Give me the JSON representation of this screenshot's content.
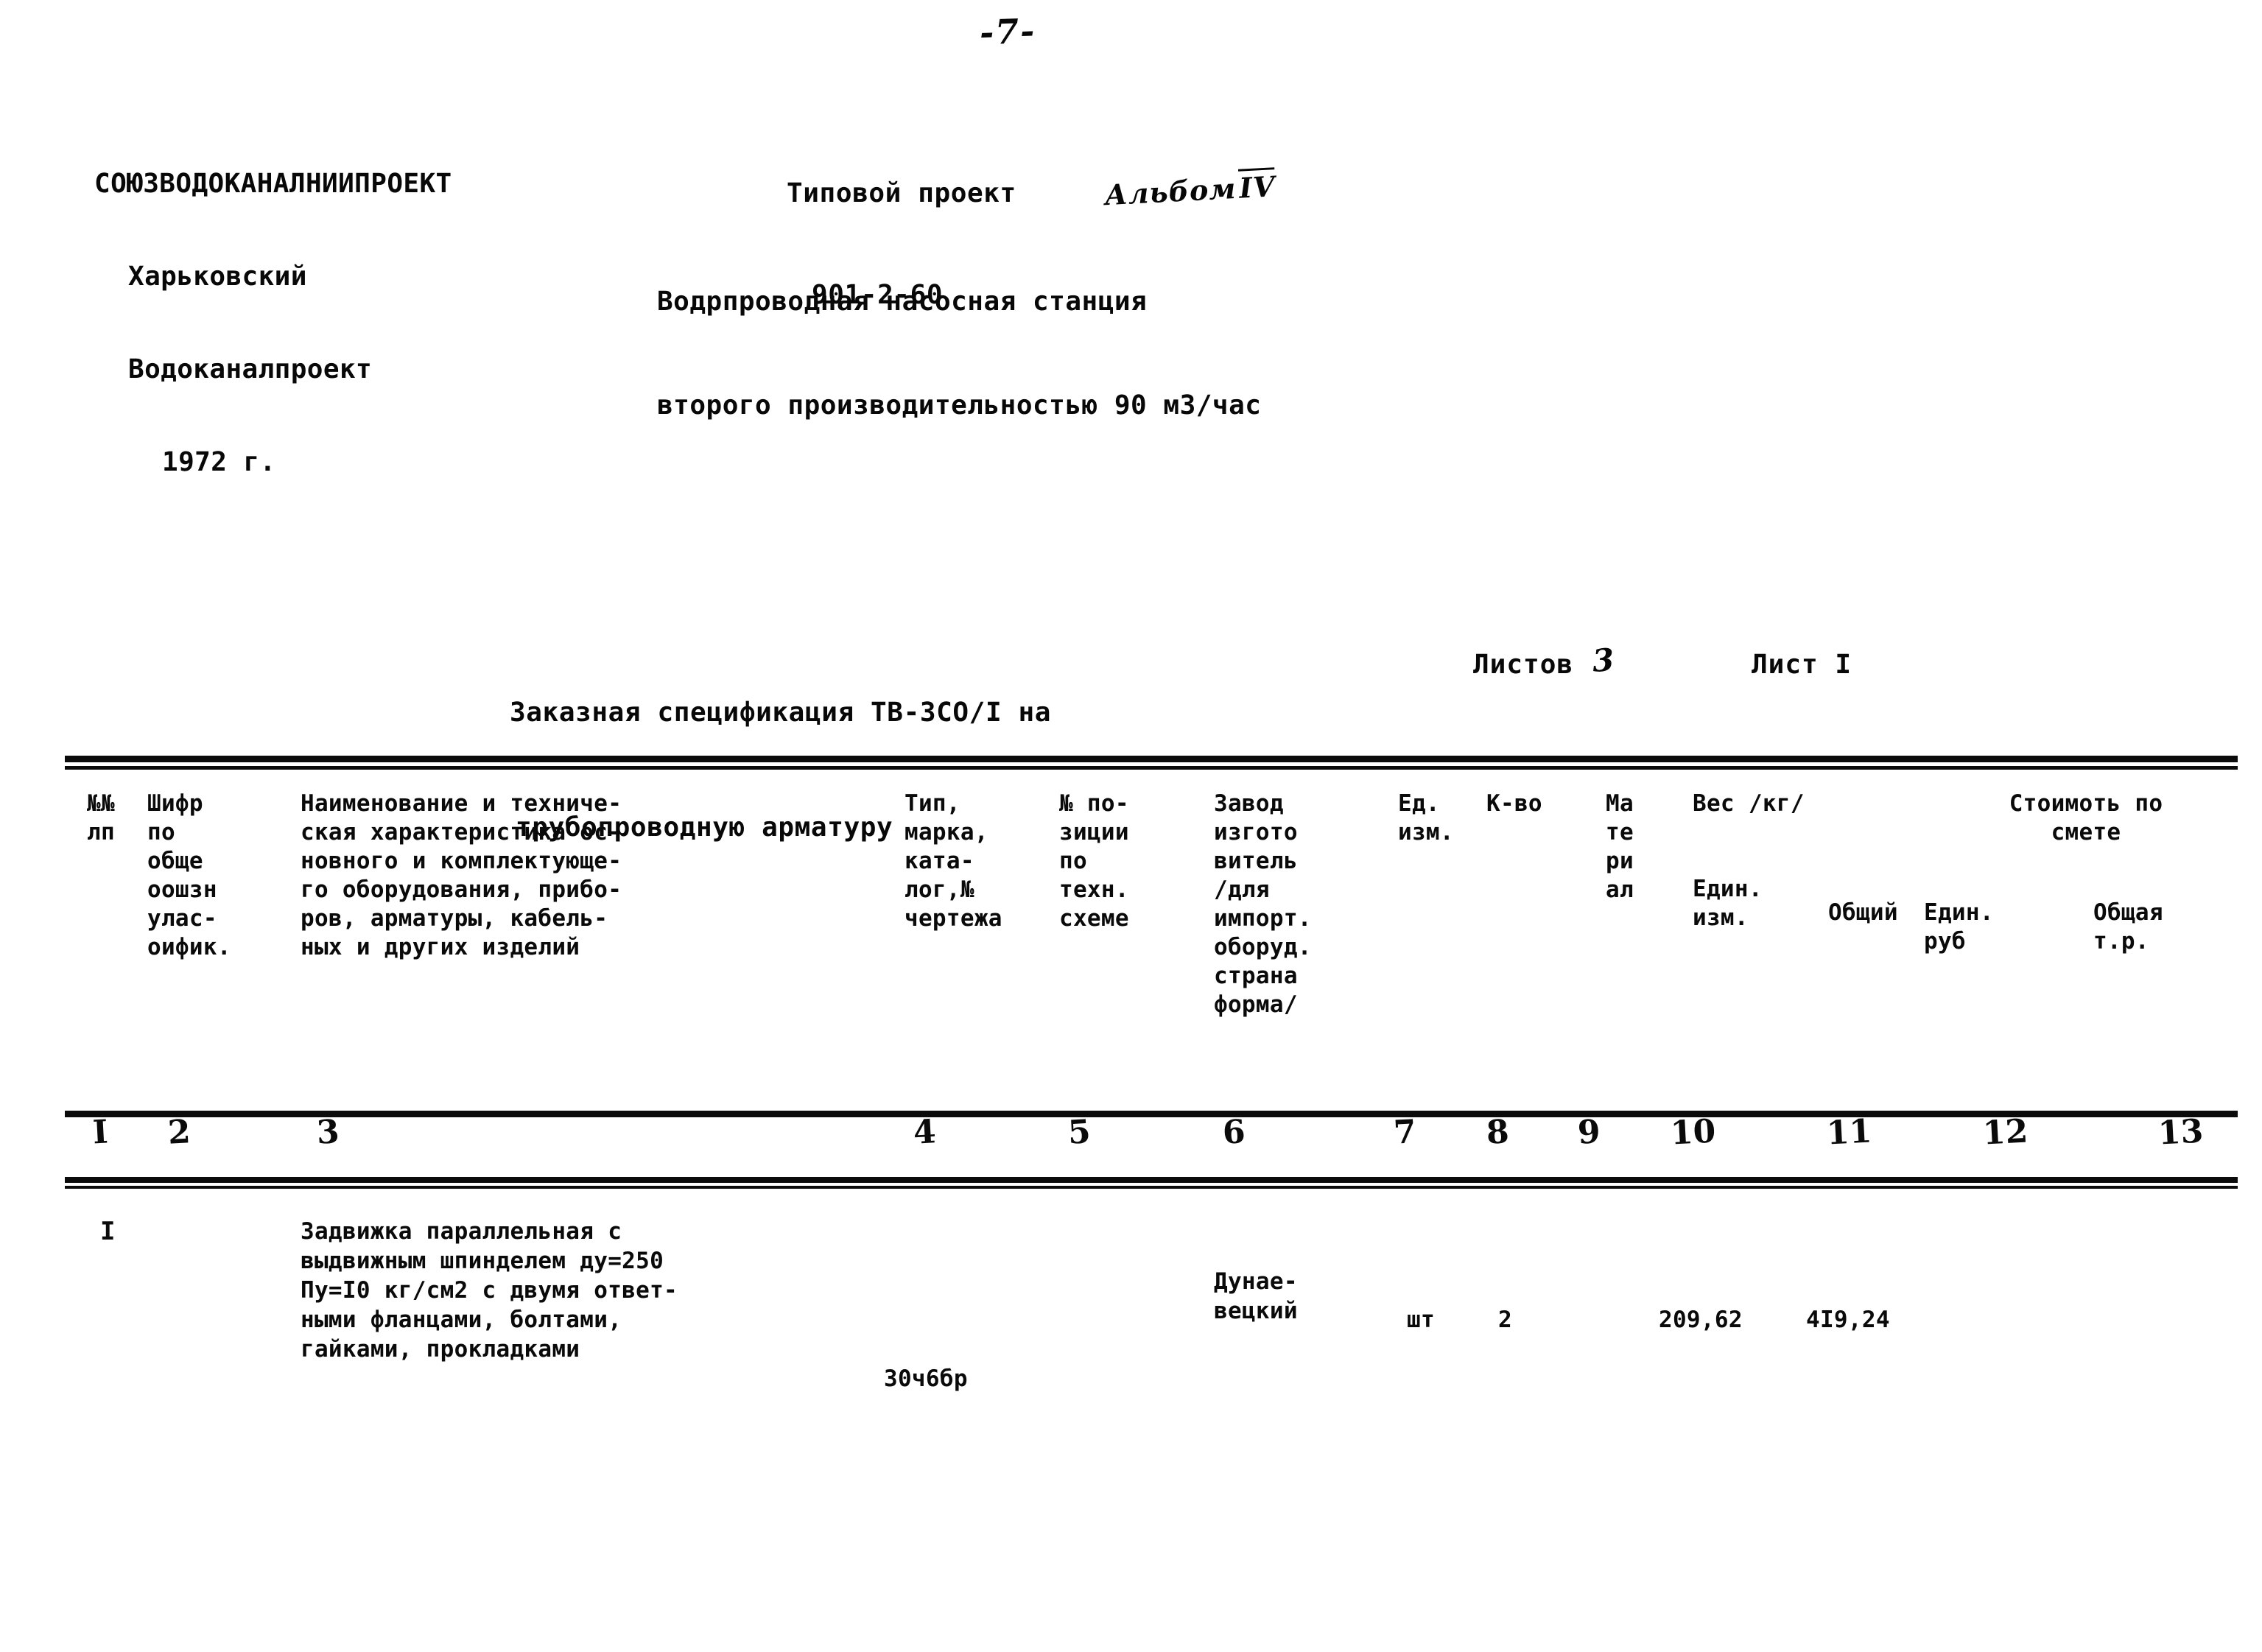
{
  "page": {
    "number": "-7-"
  },
  "header": {
    "organization": {
      "line1": "СОЮЗВОДОКАНАЛНИИПРОЕКТ",
      "line2": "Харьковский",
      "line3": "Водоканалпроект",
      "line4": "1972 г."
    },
    "project": {
      "label": "Типовой проект",
      "code": "901-2-60",
      "album_note": "Альбом",
      "album_number": "IV"
    },
    "station": {
      "line1": "Водрпроводная насосная станция",
      "line2": "второго производительностью 90 м3/час"
    }
  },
  "spec": {
    "title_line1": "Заказная спецификация ТВ-3СО/I на",
    "title_line2": "трубопроводную арматуру",
    "sheets_total_label": "Листов",
    "sheets_total_value": "3",
    "sheet_current_label": "Лист",
    "sheet_current_value": "I"
  },
  "table": {
    "headers": {
      "col1": [
        "№№",
        "лп"
      ],
      "col2": [
        "Шифр",
        "по",
        "обще",
        "оошзн",
        "улас-",
        "оифик."
      ],
      "col3": [
        "Наименование и техниче-",
        "ская характеристика ос-",
        "новного и комплектующе-",
        "го оборудования, прибо-",
        "ров, арматуры, кабель-",
        "ных и других изделий"
      ],
      "col4": [
        "Тип,",
        "марка,",
        "ката-",
        "лог,№",
        "чертежа"
      ],
      "col5": [
        "№ по-",
        "зиции",
        "по",
        "техн.",
        "схеме"
      ],
      "col6": [
        "Завод",
        "изгото",
        "витель",
        "/для",
        "импорт.",
        "оборуд.",
        "страна",
        "форма/"
      ],
      "col7": [
        "Ед.",
        "изм."
      ],
      "col8": [
        "К-во"
      ],
      "col9": [
        "Ма",
        "те",
        "ри",
        "ал"
      ],
      "col10_title": [
        "Вес /кг/"
      ],
      "col10_sub": [
        "Един.",
        "изм."
      ],
      "col11": [
        "Общий"
      ],
      "col12_13_title": [
        "Стоимоть по",
        "смете"
      ],
      "col12": [
        "Един.",
        "руб"
      ],
      "col13": [
        "Общая",
        "т.р."
      ]
    },
    "column_numbers": [
      "I",
      "2",
      "3",
      "4",
      "5",
      "6",
      "7",
      "8",
      "9",
      "10",
      "11",
      "12",
      "13"
    ],
    "rows": [
      {
        "num": "I",
        "code": "",
        "name": [
          "Задвижка параллельная с",
          "выдвижным шпинделем ду=250",
          "Пу=I0 кг/см2 с двумя ответ-",
          "ными фланцами, болтами,",
          "гайками, прокладками"
        ],
        "type": "30ч6бр",
        "position": "",
        "manufacturer": [
          "Дунае-",
          "вецкий"
        ],
        "unit": "шт",
        "qty": "2",
        "material": "",
        "weight_unit": "",
        "weight_total": "",
        "price_unit": "209,62",
        "price_total": "4I9,24"
      }
    ]
  }
}
